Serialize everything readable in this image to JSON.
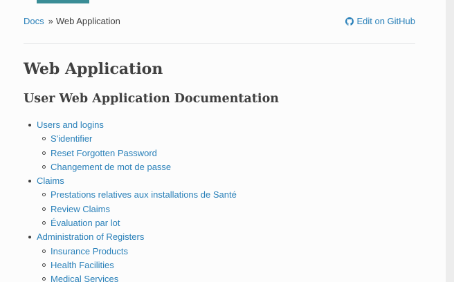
{
  "breadcrumb": {
    "root_label": "Docs",
    "separator": "»",
    "current": "Web Application",
    "edit_label": "Edit on GitHub"
  },
  "page": {
    "title": "Web Application",
    "subtitle": "User Web Application Documentation"
  },
  "toc": [
    {
      "level": 1,
      "label": "Users and logins"
    },
    {
      "level": 2,
      "label": "S'identifier"
    },
    {
      "level": 2,
      "label": "Reset Forgotten Password"
    },
    {
      "level": 2,
      "label": "Changement de mot de passe"
    },
    {
      "level": 1,
      "label": "Claims"
    },
    {
      "level": 2,
      "label": "Prestations relatives aux installations de Santé"
    },
    {
      "level": 2,
      "label": "Review Claims"
    },
    {
      "level": 2,
      "label": "Évaluation par lot"
    },
    {
      "level": 1,
      "label": "Administration of Registers"
    },
    {
      "level": 2,
      "label": "Insurance Products"
    },
    {
      "level": 2,
      "label": "Health Facilities"
    },
    {
      "level": 2,
      "label": "Medical Services"
    }
  ],
  "colors": {
    "link": "#2980b9",
    "text": "#404040",
    "accent": "#3a8d96"
  },
  "icons": {
    "edit": "github-icon"
  }
}
